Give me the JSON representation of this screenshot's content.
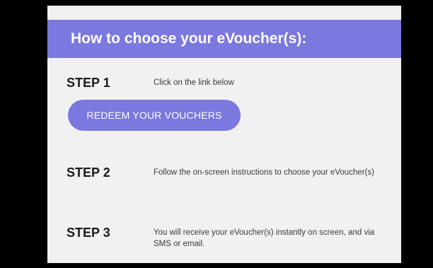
{
  "header": {
    "title": "How to choose your eVoucher(s):"
  },
  "steps": [
    {
      "label": "STEP 1",
      "description": "Click on the link below"
    },
    {
      "label": "STEP 2",
      "description": "Follow the on-screen instructions to choose your eVoucher(s)"
    },
    {
      "label": "STEP 3",
      "description": "You will receive your eVoucher(s) instantly on screen, and via SMS or email."
    }
  ],
  "redeem_button": {
    "label": "REDEEM YOUR VOUCHERS"
  },
  "colors": {
    "accent": "#7b78df",
    "background": "#f1f1f1",
    "letterbox": "#000000"
  }
}
